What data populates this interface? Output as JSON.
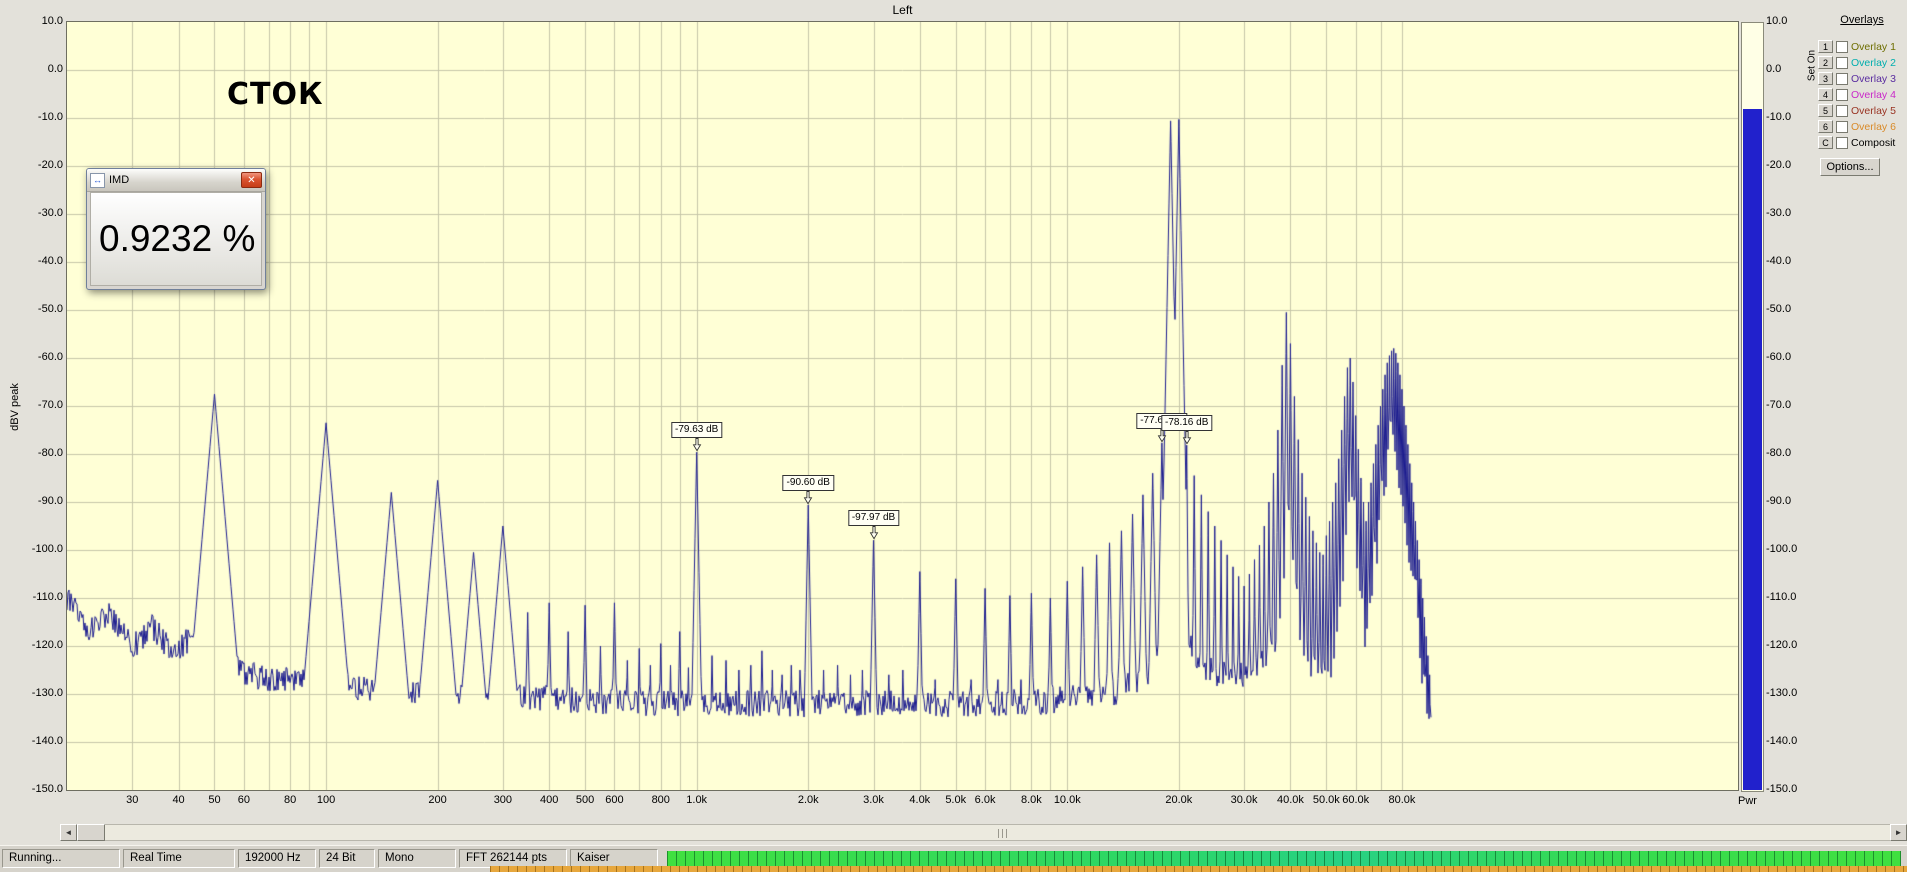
{
  "plot": {
    "annotation": "СТОК"
  },
  "chart_data": {
    "type": "line",
    "title": "Left",
    "ylabel": "dBV peak",
    "x_scale": "log",
    "x_range_hz": [
      20,
      96000
    ],
    "ylim": [
      -150,
      10
    ],
    "y_tick_step_db": 10,
    "grid": true,
    "plot_bg": "#ffffd6",
    "grid_color": "#c6c6a8",
    "trace_color": "#1a1a8e",
    "y_ticks": [
      "10.0",
      "0.0",
      "-10.0",
      "-20.0",
      "-30.0",
      "-40.0",
      "-50.0",
      "-60.0",
      "-70.0",
      "-80.0",
      "-90.0",
      "-100.0",
      "-110.0",
      "-120.0",
      "-130.0",
      "-140.0",
      "-150.0"
    ],
    "x_ticks": [
      {
        "f": 30,
        "label": "30"
      },
      {
        "f": 40,
        "label": "40"
      },
      {
        "f": 50,
        "label": "50"
      },
      {
        "f": 60,
        "label": "60"
      },
      {
        "f": 70,
        "label": ""
      },
      {
        "f": 80,
        "label": "80"
      },
      {
        "f": 90,
        "label": ""
      },
      {
        "f": 100,
        "label": "100"
      },
      {
        "f": 200,
        "label": "200"
      },
      {
        "f": 300,
        "label": "300"
      },
      {
        "f": 400,
        "label": "400"
      },
      {
        "f": 500,
        "label": "500"
      },
      {
        "f": 600,
        "label": "600"
      },
      {
        "f": 700,
        "label": ""
      },
      {
        "f": 800,
        "label": "800"
      },
      {
        "f": 900,
        "label": ""
      },
      {
        "f": 1000,
        "label": "1.0k"
      },
      {
        "f": 2000,
        "label": "2.0k"
      },
      {
        "f": 3000,
        "label": "3.0k"
      },
      {
        "f": 4000,
        "label": "4.0k"
      },
      {
        "f": 5000,
        "label": "5.0k"
      },
      {
        "f": 6000,
        "label": "6.0k"
      },
      {
        "f": 7000,
        "label": ""
      },
      {
        "f": 8000,
        "label": "8.0k"
      },
      {
        "f": 9000,
        "label": ""
      },
      {
        "f": 10000,
        "label": "10.0k"
      },
      {
        "f": 20000,
        "label": "20.0k"
      },
      {
        "f": 30000,
        "label": "30.0k"
      },
      {
        "f": 40000,
        "label": "40.0k"
      },
      {
        "f": 50000,
        "label": "50.0k"
      },
      {
        "f": 60000,
        "label": "60.0k"
      },
      {
        "f": 70000,
        "label": ""
      },
      {
        "f": 80000,
        "label": "80.0k"
      }
    ],
    "markers": [
      {
        "f": 1000,
        "db": -79.63,
        "label": "-79.63 dB"
      },
      {
        "f": 2000,
        "db": -90.6,
        "label": "-90.60 dB"
      },
      {
        "f": 3000,
        "db": -97.97,
        "label": "-97.97 dB"
      },
      {
        "f": 18000,
        "db": -77.65,
        "label": "-77.65 dB"
      },
      {
        "f": 21000,
        "db": -78.16,
        "label": "-78.16 dB"
      }
    ],
    "test_tones_hz": [
      19000,
      20000
    ],
    "peaks_dbv": [
      [
        50,
        -67.5
      ],
      [
        100,
        -73.5
      ],
      [
        150,
        -88
      ],
      [
        200,
        -85.5
      ],
      [
        250,
        -100.5
      ],
      [
        300,
        -95
      ],
      [
        350,
        -113
      ],
      [
        400,
        -111
      ],
      [
        450,
        -117
      ],
      [
        500,
        -111.5
      ],
      [
        550,
        -120
      ],
      [
        600,
        -111
      ],
      [
        650,
        -123
      ],
      [
        700,
        -120.5
      ],
      [
        750,
        -124
      ],
      [
        800,
        -119.5
      ],
      [
        850,
        -124
      ],
      [
        900,
        -117
      ],
      [
        950,
        -124.5
      ],
      [
        1000,
        -79.63
      ],
      [
        1100,
        -122
      ],
      [
        1200,
        -123
      ],
      [
        1300,
        -125
      ],
      [
        1400,
        -124
      ],
      [
        1500,
        -121
      ],
      [
        1600,
        -125
      ],
      [
        1700,
        -126
      ],
      [
        1800,
        -124
      ],
      [
        1900,
        -125
      ],
      [
        2000,
        -90.6
      ],
      [
        2200,
        -125
      ],
      [
        2400,
        -124
      ],
      [
        2600,
        -126
      ],
      [
        2800,
        -125
      ],
      [
        3000,
        -97.97
      ],
      [
        3300,
        -126
      ],
      [
        3600,
        -125
      ],
      [
        4000,
        -104.5
      ],
      [
        4400,
        -127
      ],
      [
        5000,
        -106
      ],
      [
        5500,
        -127
      ],
      [
        6000,
        -108
      ],
      [
        6500,
        -127
      ],
      [
        7000,
        -109.5
      ],
      [
        7500,
        -127
      ],
      [
        8000,
        -109
      ],
      [
        9000,
        -110
      ],
      [
        10000,
        -106.5
      ],
      [
        11000,
        -103.5
      ],
      [
        12000,
        -101
      ],
      [
        13000,
        -98.5
      ],
      [
        14000,
        -96
      ],
      [
        15000,
        -92.5
      ],
      [
        16000,
        -88.5
      ],
      [
        17000,
        -84
      ],
      [
        18000,
        -77.65
      ],
      [
        19000,
        -10.6
      ],
      [
        20000,
        -10.3
      ],
      [
        21000,
        -78.16
      ],
      [
        22000,
        -84.5
      ],
      [
        23000,
        -88.5
      ],
      [
        24000,
        -92
      ],
      [
        25000,
        -95
      ],
      [
        26000,
        -98
      ],
      [
        27000,
        -101
      ],
      [
        28000,
        -103.5
      ],
      [
        29000,
        -105.5
      ],
      [
        30000,
        -107.5
      ],
      [
        31000,
        -105
      ],
      [
        32000,
        -102
      ],
      [
        33000,
        -99
      ],
      [
        34000,
        -95
      ],
      [
        35000,
        -90
      ],
      [
        36000,
        -84
      ],
      [
        37000,
        -75
      ],
      [
        38000,
        -61.5
      ],
      [
        39000,
        -50.5
      ],
      [
        40000,
        -57
      ],
      [
        41000,
        -68
      ],
      [
        42000,
        -77
      ],
      [
        43000,
        -84
      ],
      [
        44000,
        -89
      ],
      [
        45000,
        -93
      ],
      [
        46000,
        -96
      ],
      [
        47000,
        -98.5
      ],
      [
        48000,
        -100.5
      ],
      [
        49000,
        -101
      ],
      [
        50000,
        -97
      ],
      [
        51000,
        -94
      ],
      [
        52000,
        -90
      ],
      [
        53000,
        -86
      ],
      [
        54000,
        -81
      ],
      [
        55000,
        -75
      ],
      [
        56000,
        -68
      ],
      [
        57000,
        -62
      ],
      [
        58000,
        -60
      ],
      [
        59000,
        -65
      ],
      [
        60000,
        -72
      ],
      [
        61000,
        -79
      ],
      [
        62000,
        -85
      ],
      [
        63000,
        -90
      ],
      [
        64000,
        -94
      ],
      [
        65000,
        -90
      ],
      [
        66000,
        -86
      ],
      [
        67000,
        -82
      ],
      [
        68000,
        -78
      ],
      [
        69000,
        -74
      ],
      [
        70000,
        -70
      ],
      [
        71000,
        -66.5
      ],
      [
        72000,
        -63.5
      ],
      [
        73000,
        -61
      ],
      [
        74000,
        -59.5
      ],
      [
        75000,
        -58.5
      ],
      [
        76000,
        -58
      ],
      [
        77000,
        -59
      ],
      [
        78000,
        -61
      ],
      [
        79000,
        -63.5
      ],
      [
        80000,
        -66.5
      ],
      [
        81000,
        -70
      ],
      [
        82000,
        -74
      ],
      [
        83000,
        -78
      ],
      [
        84000,
        -82
      ],
      [
        85000,
        -86
      ],
      [
        86000,
        -90
      ],
      [
        87000,
        -94
      ],
      [
        88000,
        -98
      ],
      [
        89000,
        -102
      ],
      [
        90000,
        -106
      ],
      [
        91000,
        -110
      ],
      [
        92000,
        -114
      ],
      [
        93000,
        -118
      ],
      [
        94000,
        -122
      ],
      [
        95000,
        -126
      ]
    ],
    "noise_floor_dbv": [
      [
        20,
        -110
      ],
      [
        23,
        -117
      ],
      [
        26,
        -113
      ],
      [
        30,
        -120
      ],
      [
        34,
        -116
      ],
      [
        38,
        -121
      ],
      [
        44,
        -118
      ],
      [
        50,
        -119
      ],
      [
        58,
        -125
      ],
      [
        70,
        -127
      ],
      [
        85,
        -127
      ],
      [
        100,
        -127
      ],
      [
        130,
        -129
      ],
      [
        170,
        -130
      ],
      [
        250,
        -130.5
      ],
      [
        400,
        -131
      ],
      [
        700,
        -132
      ],
      [
        1200,
        -132
      ],
      [
        2500,
        -132
      ],
      [
        5000,
        -132
      ],
      [
        9000,
        -131.5
      ],
      [
        13000,
        -130
      ],
      [
        16000,
        -127
      ],
      [
        17500,
        -123
      ],
      [
        18700,
        -118
      ],
      [
        19500,
        -114
      ],
      [
        20400,
        -115
      ],
      [
        21500,
        -120
      ],
      [
        23000,
        -124
      ],
      [
        26000,
        -126
      ],
      [
        30000,
        -126
      ],
      [
        34000,
        -122
      ],
      [
        38000,
        -118
      ],
      [
        40000,
        -120
      ],
      [
        44000,
        -124
      ],
      [
        48000,
        -126
      ],
      [
        52000,
        -127
      ],
      [
        57000,
        -127
      ],
      [
        62000,
        -128
      ],
      [
        68000,
        -130
      ],
      [
        75000,
        -131
      ],
      [
        82000,
        -132
      ],
      [
        90000,
        -133
      ],
      [
        96000,
        -134
      ]
    ]
  },
  "meter": {
    "label": "Pwr",
    "level_db": -8,
    "fill_color": "#2121cc"
  },
  "imd_dialog": {
    "title": "IMD",
    "value": "0.9232 %"
  },
  "icons": {
    "close": "✕",
    "dialog": "↔",
    "scroll_left": "◄",
    "scroll_right": "►"
  },
  "overlays_panel": {
    "title": "Overlays",
    "column_header": "Set On",
    "options_label": "Options...",
    "items": [
      {
        "num": "1",
        "label": "Overlay 1",
        "color": "#6e6e00",
        "checked": false
      },
      {
        "num": "2",
        "label": "Overlay 2",
        "color": "#00aeae",
        "checked": false
      },
      {
        "num": "3",
        "label": "Overlay 3",
        "color": "#5a2da0",
        "checked": false
      },
      {
        "num": "4",
        "label": "Overlay 4",
        "color": "#c928c9",
        "checked": false
      },
      {
        "num": "5",
        "label": "Overlay 5",
        "color": "#993322",
        "checked": false
      },
      {
        "num": "6",
        "label": "Overlay 6",
        "color": "#d98a28",
        "checked": false
      },
      {
        "num": "C",
        "label": "Composit",
        "color": "#000000",
        "checked": false
      }
    ]
  },
  "statusbar": {
    "items": [
      "Running...",
      "Real Time",
      "192000 Hz",
      "24 Bit",
      "Mono",
      "FFT 262144 pts",
      "Kaiser"
    ]
  }
}
